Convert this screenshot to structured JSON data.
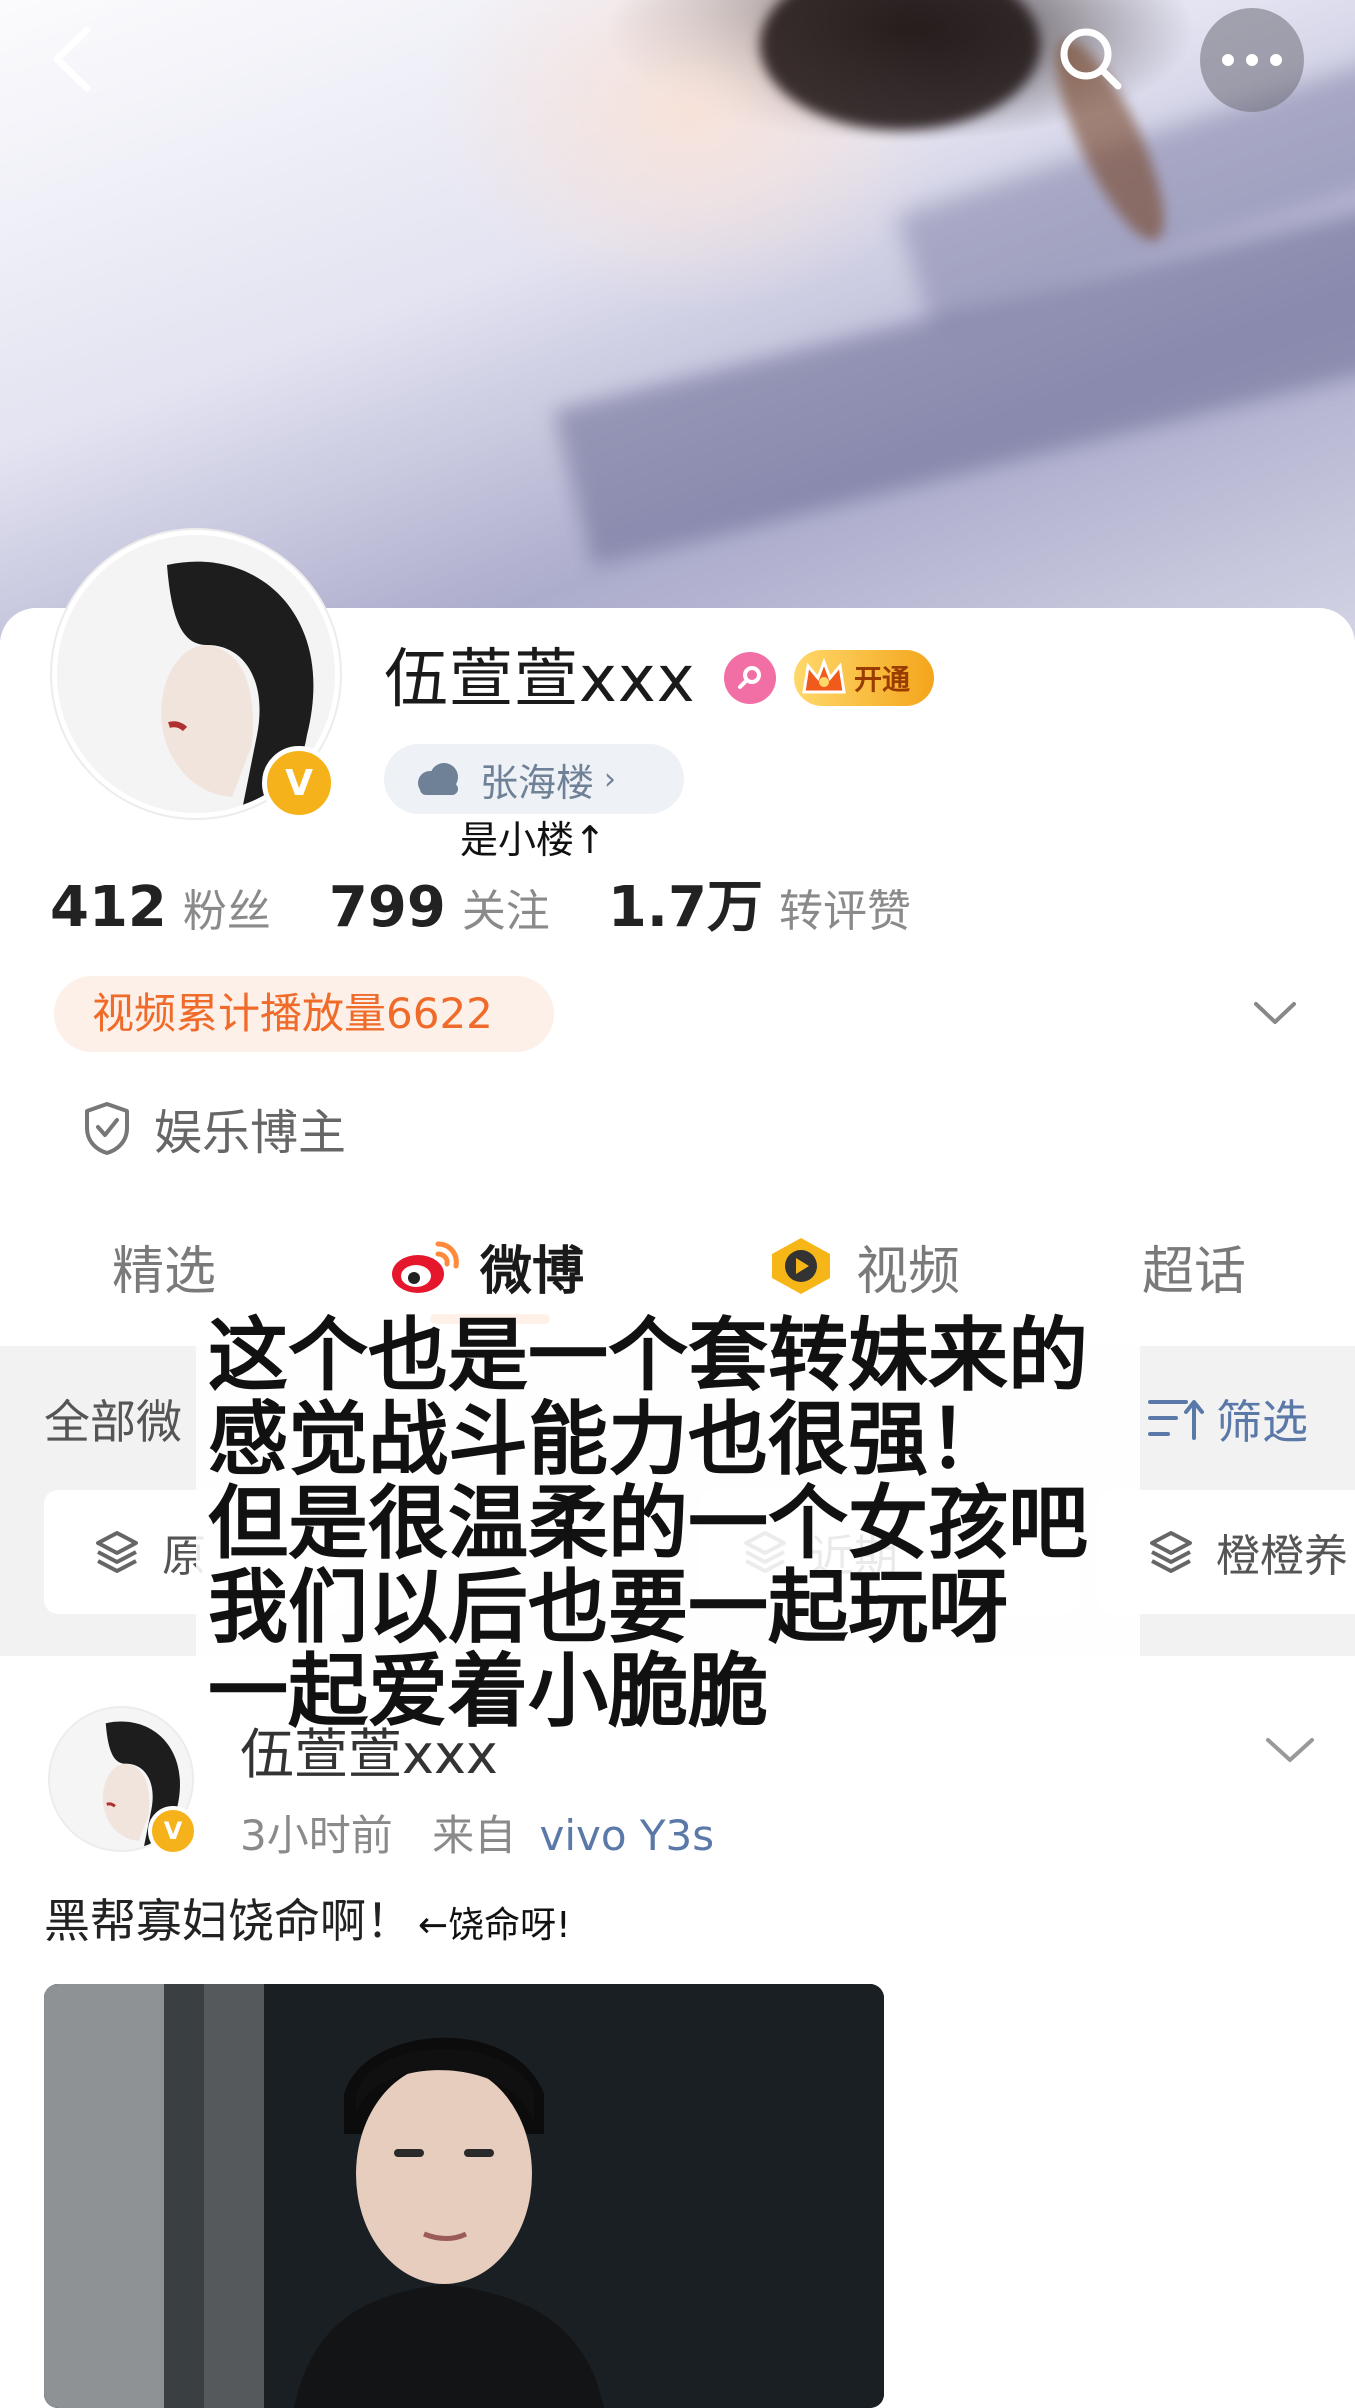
{
  "topbar": {
    "back_icon": "chevron-left-icon",
    "search_icon": "search-icon",
    "more_icon": "more-dots-icon"
  },
  "profile": {
    "name": "伍萱萱xxx",
    "vip_label": "开通",
    "location": "张海楼",
    "location_chevron": "›",
    "annotation": "是小楼↑",
    "stats": [
      {
        "value": "412",
        "label": "粉丝"
      },
      {
        "value": "799",
        "label": "关注"
      },
      {
        "value": "1.7万",
        "label": "转评赞"
      }
    ],
    "play_count": "视频累计播放量6622",
    "category": "娱乐博主"
  },
  "tabs": [
    {
      "label": "精选"
    },
    {
      "label": "微博"
    },
    {
      "label": "视频"
    },
    {
      "label": "超话"
    }
  ],
  "filter": {
    "all_label": "全部微",
    "filter_label": "筛选",
    "chips": [
      "原",
      "近期",
      "橙橙养"
    ]
  },
  "overlay_caption": "这个也是一个套转妹来的\n感觉战斗能力也很强！\n但是很温柔的一个女孩吧\n我们以后也要一起玩呀\n一起爱着小脆脆",
  "post": {
    "author": "伍萱萱xxx",
    "time": "3小时前",
    "source_prefix": "来自",
    "device": "vivo Y3s",
    "text": "黑帮寡妇饶命啊！",
    "note": "←饶命呀!"
  },
  "colors": {
    "accent_orange": "#ff8a3c",
    "link_blue": "#5b79a8",
    "verified_gold": "#f6b21a",
    "female_pink": "#f26fa6"
  }
}
